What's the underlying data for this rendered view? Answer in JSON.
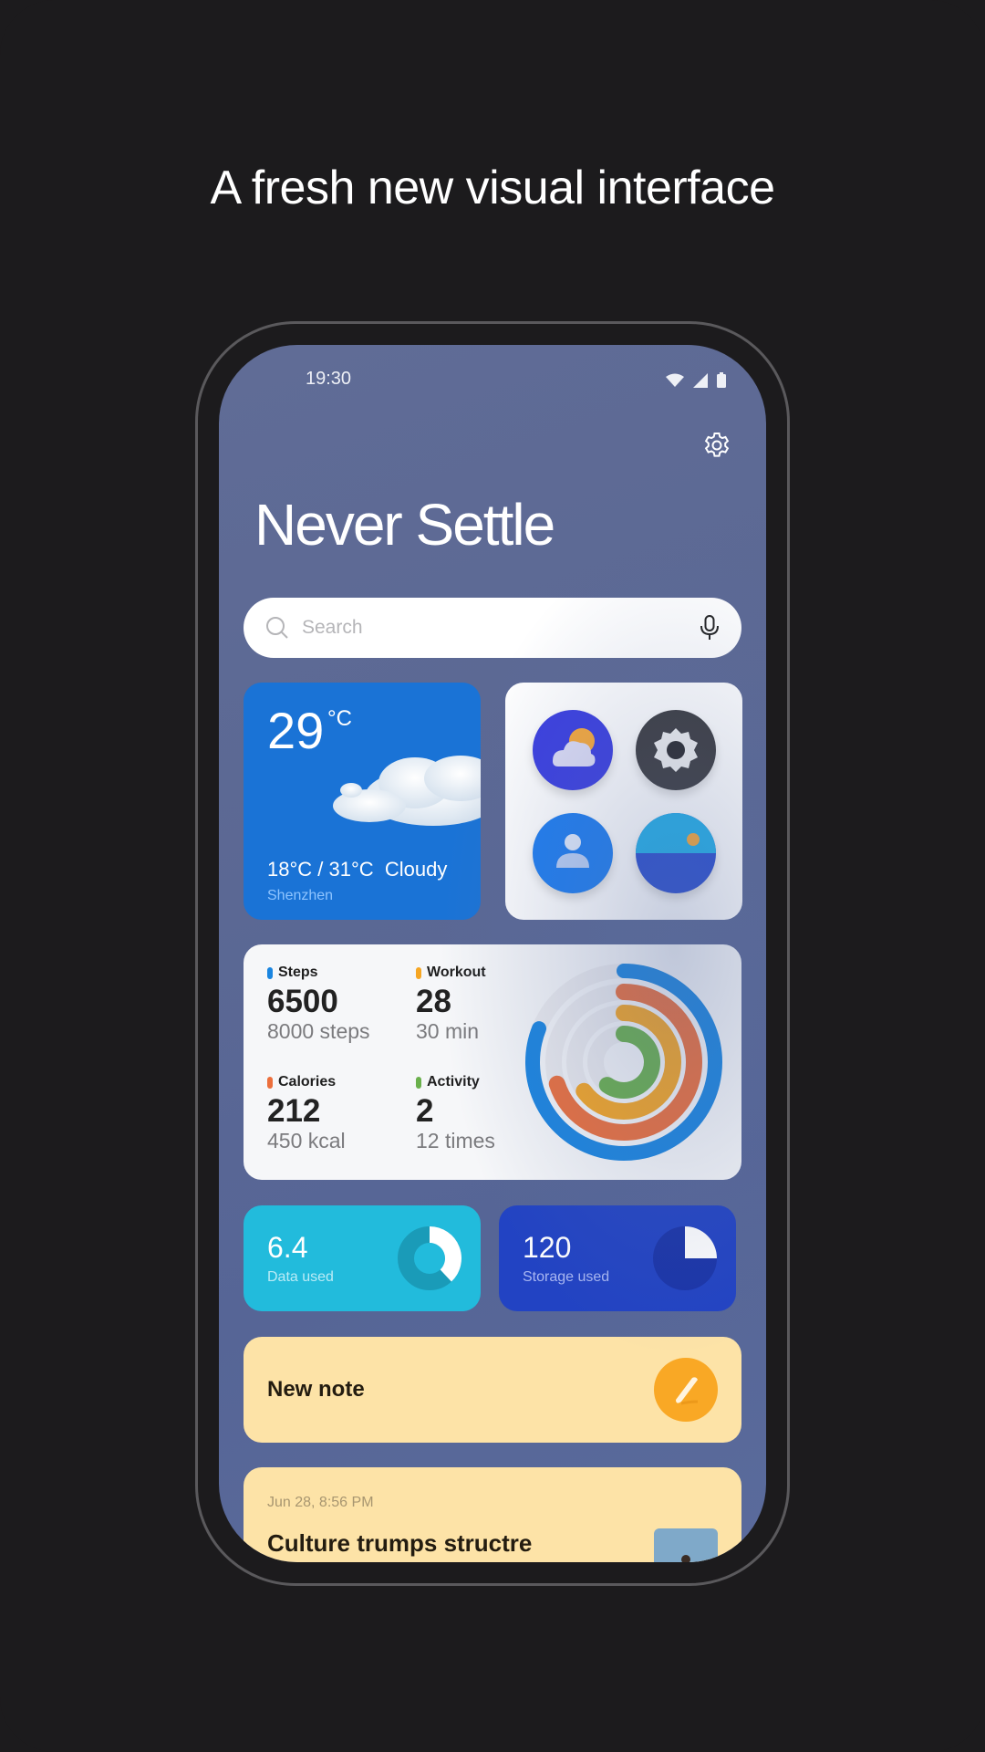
{
  "headline": "A fresh new visual interface",
  "status_bar": {
    "time": "19:30",
    "icons": [
      "wifi-icon",
      "signal-icon",
      "battery-icon"
    ]
  },
  "home": {
    "title": "Never Settle",
    "settings_icon": "gear-icon",
    "search": {
      "placeholder": "Search",
      "value": "",
      "left_icon": "search-icon",
      "right_icon": "microphone-icon"
    }
  },
  "weather": {
    "temperature": "29",
    "unit": "°C",
    "range": "18°C / 31°C",
    "condition": "Cloudy",
    "city": "Shenzhen",
    "colors": {
      "card": "#1a73d6"
    }
  },
  "app_folder": {
    "apps": [
      {
        "name": "Weather",
        "icon": "weather-app-icon"
      },
      {
        "name": "Settings",
        "icon": "settings-app-icon"
      },
      {
        "name": "Contacts",
        "icon": "contacts-app-icon"
      },
      {
        "name": "Gallery",
        "icon": "gallery-app-icon"
      }
    ]
  },
  "health": {
    "metrics": [
      {
        "label": "Steps",
        "value": "6500",
        "goal": "8000 steps",
        "color": "#1a85e0",
        "progress": 0.81
      },
      {
        "label": "Workout",
        "value": "28",
        "goal": "30 min",
        "color": "#f6a623",
        "progress": 0.65
      },
      {
        "label": "Calories",
        "value": "212",
        "goal": "450 kcal",
        "color": "#ec6f3c",
        "progress": 0.7
      },
      {
        "label": "Activity",
        "value": "2",
        "goal": "12 times",
        "color": "#6ab04c",
        "progress": 0.6
      }
    ]
  },
  "tiles": {
    "data": {
      "value": "6.4",
      "label": "Data used",
      "fraction": 0.38
    },
    "storage": {
      "value": "120",
      "label": "Storage used",
      "fraction": 0.25
    }
  },
  "note": {
    "label": "New note",
    "icon": "pencil-icon"
  },
  "memo": {
    "date": "Jun 28, 8:56 PM",
    "title": "Culture trumps structre"
  }
}
